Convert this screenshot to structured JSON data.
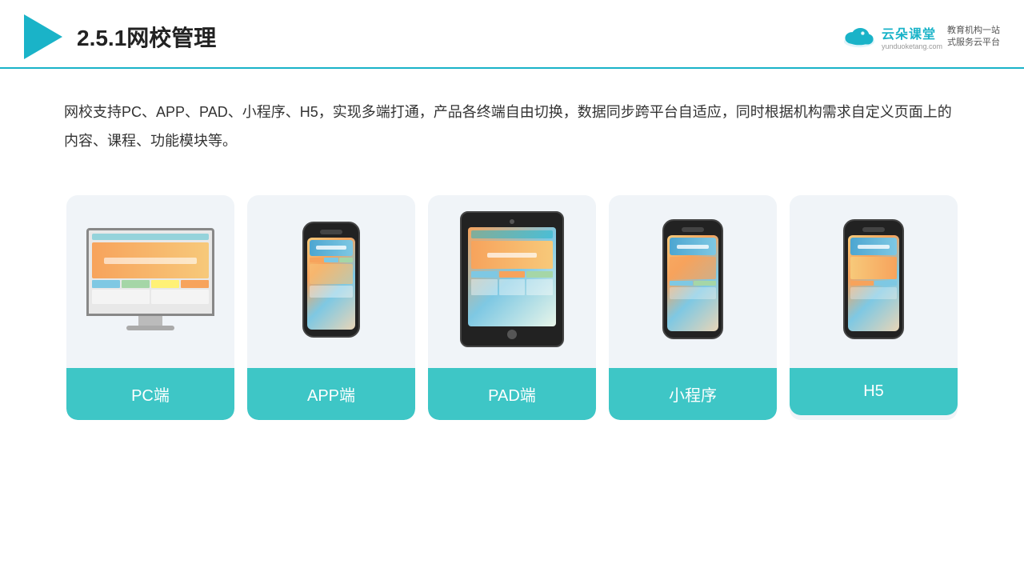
{
  "header": {
    "title": "2.5.1网校管理",
    "brand": {
      "name": "云朵课堂",
      "url": "yunduoketang.com",
      "tagline": "教育机构一站\n式服务云平台"
    }
  },
  "description": "网校支持PC、APP、PAD、小程序、H5，实现多端打通，产品各终端自由切换，数据同步跨平台自适应，同时根据机构需求自定义页面上的内容、课程、功能模块等。",
  "cards": [
    {
      "id": "pc",
      "label": "PC端"
    },
    {
      "id": "app",
      "label": "APP端"
    },
    {
      "id": "pad",
      "label": "PAD端"
    },
    {
      "id": "miniapp",
      "label": "小程序"
    },
    {
      "id": "h5",
      "label": "H5"
    }
  ],
  "colors": {
    "teal": "#3ec6c6",
    "accent": "#1ab3c8"
  }
}
